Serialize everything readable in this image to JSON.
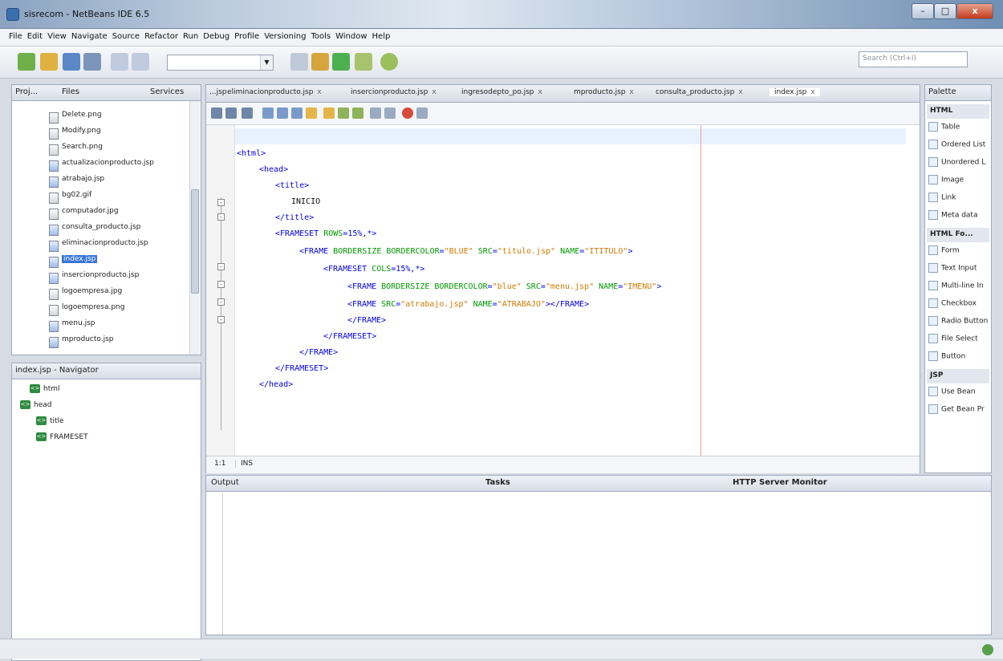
{
  "window": {
    "title": "sisrecom - NetBeans IDE 6.5",
    "min": "–",
    "max": "□",
    "close": "x"
  },
  "menu": [
    "File",
    "Edit",
    "View",
    "Navigate",
    "Source",
    "Refactor",
    "Run",
    "Debug",
    "Profile",
    "Versioning",
    "Tools",
    "Window",
    "Help"
  ],
  "search": {
    "placeholder": "Search (Ctrl+I)"
  },
  "projects": {
    "tabs": [
      "Proj...",
      "Files",
      "Services"
    ],
    "files": [
      {
        "name": "Delete.png",
        "kind": "img"
      },
      {
        "name": "Modify.png",
        "kind": "img"
      },
      {
        "name": "Search.png",
        "kind": "img"
      },
      {
        "name": "actualizacionproducto.jsp",
        "kind": "jsp"
      },
      {
        "name": "atrabajo.jsp",
        "kind": "jsp"
      },
      {
        "name": "bg02.gif",
        "kind": "img"
      },
      {
        "name": "computador.jpg",
        "kind": "img"
      },
      {
        "name": "consulta_producto.jsp",
        "kind": "jsp"
      },
      {
        "name": "eliminacionproducto.jsp",
        "kind": "jsp"
      },
      {
        "name": "index.jsp",
        "kind": "jsp",
        "selected": true
      },
      {
        "name": "insercionproducto.jsp",
        "kind": "jsp"
      },
      {
        "name": "logoempresa.jpg",
        "kind": "img"
      },
      {
        "name": "logoempresa.png",
        "kind": "img"
      },
      {
        "name": "menu.jsp",
        "kind": "jsp"
      },
      {
        "name": "mproducto.jsp",
        "kind": "jsp"
      }
    ]
  },
  "navigator": {
    "title": "index.jsp - Navigator",
    "nodes": [
      "html",
      "head",
      "title",
      "FRAMESET"
    ],
    "tag_icon": "<>"
  },
  "editor": {
    "tabs": [
      "...jsp",
      "eliminacionproducto.jsp",
      "insercionproducto.jsp",
      "ingresodepto_po.jsp",
      "mproducto.jsp",
      "consulta_producto.jsp",
      "index.jsp"
    ],
    "tab_close": "x",
    "code": {
      "l1": "<html>",
      "l2": "<head>",
      "l3": "<title>",
      "l4": "INICIO",
      "l5": "</title>",
      "l6a": "<FRAMESET ",
      "l6b": "ROWS",
      "l6c": "=15%,*>",
      "l7a": "<FRAME ",
      "l7b": "BORDERSIZE BORDERCOLOR",
      "l7c": "=",
      "l7d": "\"BLUE\"",
      "l7e": " SRC",
      "l7f": "=",
      "l7g": "\"titulo.jsp\"",
      "l7h": " NAME",
      "l7i": "=",
      "l7j": "\"ITITULO\"",
      "l7k": ">",
      "l8a": "<FRAMESET ",
      "l8b": "COLS",
      "l8c": "=15%,*>",
      "l9a": "<FRAME ",
      "l9b": "BORDERSIZE BORDERCOLOR",
      "l9c": "=",
      "l9d": "\"blue\"",
      "l9e": " SRC",
      "l9f": "=",
      "l9g": "\"menu.jsp\"",
      "l9h": " NAME",
      "l9i": "=",
      "l9j": "\"IMENU\"",
      "l9k": ">",
      "l10a": "<FRAME ",
      "l10b": "SRC",
      "l10c": "=",
      "l10d": "\"atrabajo.jsp\"",
      "l10e": " NAME",
      "l10f": "=",
      "l10g": "\"ATRABAJO\"",
      "l10h": "></FRAME>",
      "l11": "</FRAME>",
      "l12": "</FRAMESET>",
      "l13": "</FRAME>",
      "l14": "</FRAMESET>",
      "l15": "</head>"
    },
    "position": "1:1",
    "mode": "INS"
  },
  "palette": {
    "title": "Palette",
    "cat_html": "HTML",
    "html_items": [
      "Table",
      "Ordered List",
      "Unordered L",
      "Image",
      "Link",
      "Meta data"
    ],
    "cat_forms": "HTML Fo...",
    "form_items": [
      "Form",
      "Text Input",
      "Multi-line In",
      "Checkbox",
      "Radio Button",
      "File Select",
      "Button"
    ],
    "cat_jsp": "JSP",
    "jsp_items": [
      "Use Bean",
      "Get Bean Pr"
    ]
  },
  "output": {
    "tabs": [
      "Output",
      "Tasks",
      "HTTP Server Monitor"
    ]
  }
}
